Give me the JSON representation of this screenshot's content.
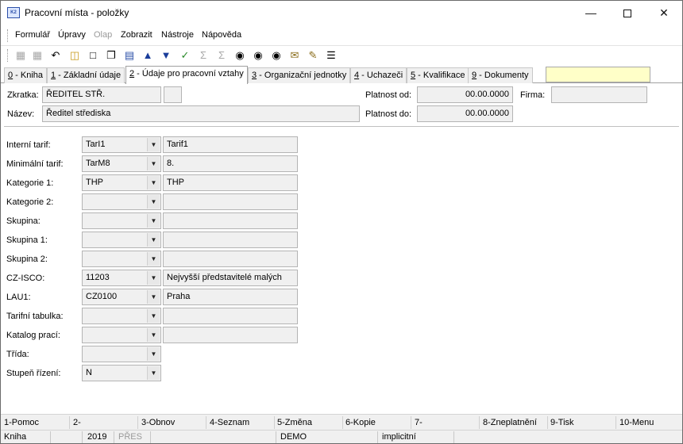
{
  "window": {
    "title": "Pracovní místa - položky",
    "app_icon": "app-logo-icon"
  },
  "menu": [
    {
      "label": "Formulář",
      "disabled": false
    },
    {
      "label": "Úpravy",
      "disabled": false
    },
    {
      "label": "Olap",
      "disabled": true
    },
    {
      "label": "Zobrazit",
      "disabled": false
    },
    {
      "label": "Nástroje",
      "disabled": false
    },
    {
      "label": "Nápověda",
      "disabled": false
    }
  ],
  "toolbar_icons": [
    "save-icon",
    "save-as-icon",
    "undo-icon",
    "open-folder-icon",
    "new-document-icon",
    "copy-icon",
    "book-icon",
    "arrow-up-icon",
    "arrow-down-icon",
    "filter-icon",
    "sum-icon",
    "sum-filter-icon",
    "binoculars-icon",
    "binoculars-next-icon",
    "binoculars-all-icon",
    "mail-icon",
    "edit-list-icon",
    "menu-lines-icon"
  ],
  "tabs": [
    {
      "key": "0",
      "label": " - Kniha"
    },
    {
      "key": "1",
      "label": " - Základní údaje"
    },
    {
      "key": "2",
      "label": " - Údaje pro pracovní vztahy"
    },
    {
      "key": "3",
      "label": " - Organizační jednotky"
    },
    {
      "key": "4",
      "label": " - Uchazeči"
    },
    {
      "key": "5",
      "label": " - Kvalifikace"
    },
    {
      "key": "9",
      "label": " - Dokumenty"
    }
  ],
  "header": {
    "zkratka_label": "Zkratka:",
    "zkratka_value": "ŘEDITEL STŘ.",
    "nazev_label": "Název:",
    "nazev_value": "Ředitel střediska",
    "platnost_od_label": "Platnost od:",
    "platnost_od_value": "00.00.0000",
    "platnost_do_label": "Platnost do:",
    "platnost_do_value": "00.00.0000",
    "firma_label": "Firma:",
    "firma_value": ""
  },
  "fields": [
    {
      "label": "Interní tarif:",
      "code": "TarI1",
      "desc": "Tarif1",
      "has_desc": true
    },
    {
      "label": "Minimální tarif:",
      "code": "TarM8",
      "desc": "8.",
      "has_desc": true
    },
    {
      "label": "Kategorie 1:",
      "code": "THP",
      "desc": "THP",
      "has_desc": true
    },
    {
      "label": "Kategorie 2:",
      "code": "",
      "desc": "",
      "has_desc": true
    },
    {
      "label": "Skupina:",
      "code": "",
      "desc": "",
      "has_desc": true
    },
    {
      "label": "Skupina 1:",
      "code": "",
      "desc": "",
      "has_desc": true
    },
    {
      "label": "Skupina 2:",
      "code": "",
      "desc": "",
      "has_desc": true
    },
    {
      "label": "CZ-ISCO:",
      "code": "11203",
      "desc": "Nejvyšší představitelé malých",
      "has_desc": true
    },
    {
      "label": "LAU1:",
      "code": "CZ0100",
      "desc": "Praha",
      "has_desc": true
    },
    {
      "label": "Tarifní tabulka:",
      "code": "",
      "desc": "",
      "has_desc": true
    },
    {
      "label": "Katalog prací:",
      "code": "",
      "desc": "",
      "has_desc": true
    },
    {
      "label": "Třída:",
      "code": "",
      "desc": "",
      "has_desc": false
    },
    {
      "label": "Stupeň řízení:",
      "code": "N",
      "desc": "",
      "has_desc": false
    }
  ],
  "fkeys": [
    "1-Pomoc",
    "2-",
    "3-Obnov",
    "4-Seznam",
    "5-Změna",
    "6-Kopie",
    "7-",
    "8-Zneplatnění",
    "9-Tisk",
    "10-Menu"
  ],
  "status": {
    "module": "Kniha",
    "year": "2019",
    "mode": "PŘES",
    "database": "DEMO",
    "profile": "implicitní"
  }
}
